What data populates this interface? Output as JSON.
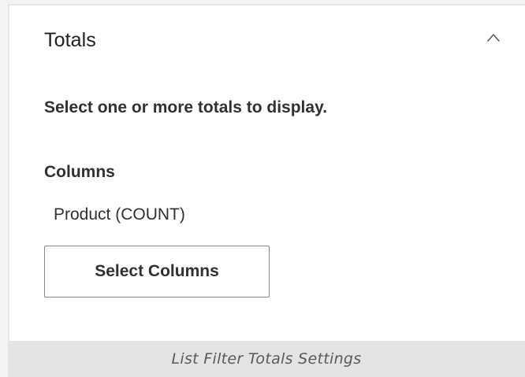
{
  "section": {
    "title": "Totals",
    "collapse_icon": "chevron-up-icon",
    "expanded": true
  },
  "description": "Select one or more totals to display.",
  "columns": {
    "label": "Columns",
    "selected": [
      "Product (COUNT)"
    ],
    "button_label": "Select Columns"
  },
  "caption": "List Filter Totals Settings",
  "colors": {
    "text": "#323130",
    "button_border": "#8a8886",
    "caption_bg": "#e4e4e4",
    "caption_text": "#595959"
  }
}
